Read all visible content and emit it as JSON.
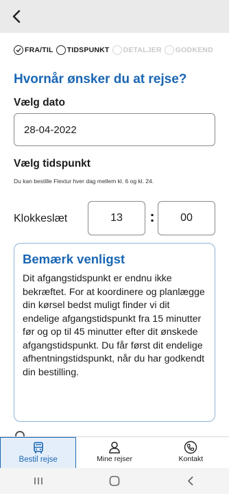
{
  "header": {
    "back_icon": "chevron-left-icon"
  },
  "steps": [
    {
      "label": "FRA/TIL",
      "state": "done"
    },
    {
      "label": "TIDSPUNKT",
      "state": "current"
    },
    {
      "label": "DETALJER",
      "state": "inactive"
    },
    {
      "label": "GODKEND",
      "state": "inactive"
    }
  ],
  "page": {
    "heading": "Hvornår ønsker du at rejse?",
    "date_label": "Vælg dato",
    "date_value": "28-04-2022",
    "time_label": "Vælg tidspunkt",
    "time_hint": "Du kan bestille Flextur hver dag mellem kl. 6 og kl. 24.",
    "clock_label": "Klokkeslæt",
    "hour": "13",
    "separator": ":",
    "minute": "00"
  },
  "notice": {
    "title": "Bemærk venligst",
    "body": "Dit afgangstidspunkt er endnu ikke bekræftet. For at koordinere og planlægge din kørsel bedst muligt finder vi dit endelige afgangstidspunkt fra 15 minutter før og op til 45 minutter efter dit ønskede afgangstidspunkt. Du får først dit endelige afhentningstidspunkt, når du har godkendt din bestilling."
  },
  "tabs": [
    {
      "label": "Bestil rejse",
      "icon": "bus-icon",
      "active": true
    },
    {
      "label": "Mine rejser",
      "icon": "person-icon",
      "active": false
    },
    {
      "label": "Kontakt",
      "icon": "phone-icon",
      "active": false
    }
  ],
  "colors": {
    "accent": "#1a66b3",
    "inactive": "#c9c9c9",
    "header_bg": "#eaeaea"
  }
}
